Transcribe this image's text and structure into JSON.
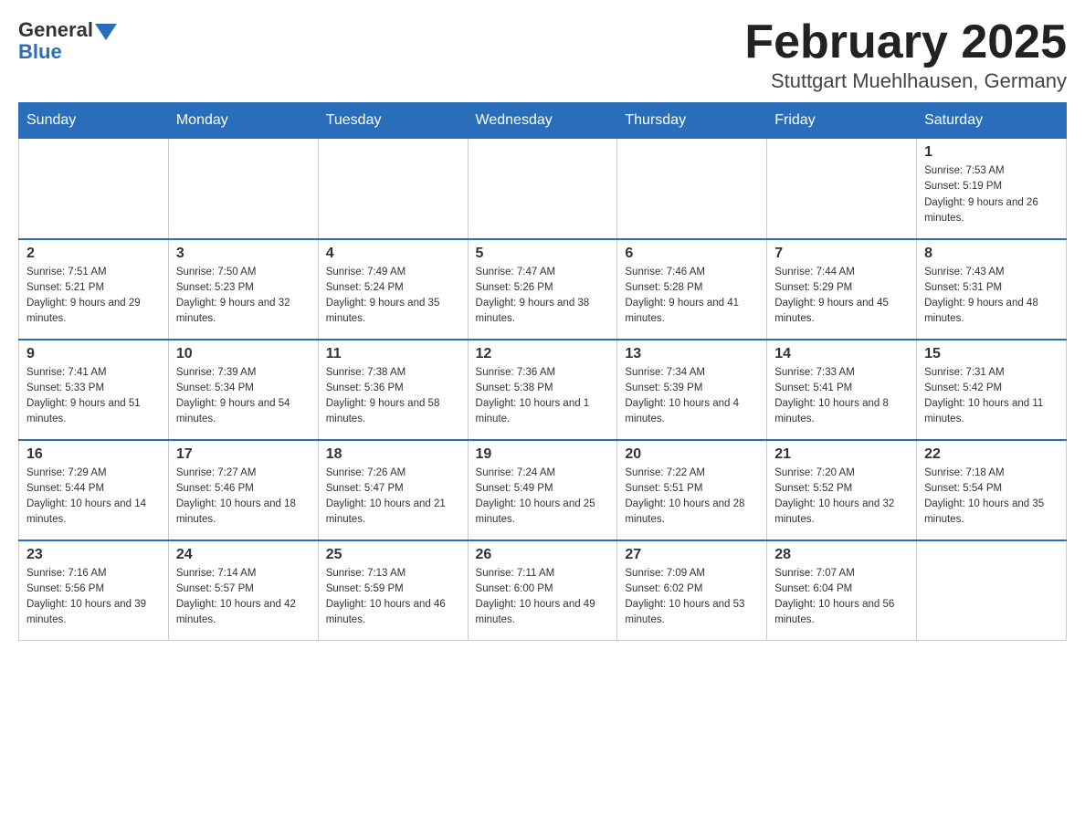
{
  "logo": {
    "general": "General",
    "blue": "Blue"
  },
  "title": "February 2025",
  "location": "Stuttgart Muehlhausen, Germany",
  "weekdays": [
    "Sunday",
    "Monday",
    "Tuesday",
    "Wednesday",
    "Thursday",
    "Friday",
    "Saturday"
  ],
  "weeks": [
    [
      {
        "day": "",
        "info": ""
      },
      {
        "day": "",
        "info": ""
      },
      {
        "day": "",
        "info": ""
      },
      {
        "day": "",
        "info": ""
      },
      {
        "day": "",
        "info": ""
      },
      {
        "day": "",
        "info": ""
      },
      {
        "day": "1",
        "info": "Sunrise: 7:53 AM\nSunset: 5:19 PM\nDaylight: 9 hours and 26 minutes."
      }
    ],
    [
      {
        "day": "2",
        "info": "Sunrise: 7:51 AM\nSunset: 5:21 PM\nDaylight: 9 hours and 29 minutes."
      },
      {
        "day": "3",
        "info": "Sunrise: 7:50 AM\nSunset: 5:23 PM\nDaylight: 9 hours and 32 minutes."
      },
      {
        "day": "4",
        "info": "Sunrise: 7:49 AM\nSunset: 5:24 PM\nDaylight: 9 hours and 35 minutes."
      },
      {
        "day": "5",
        "info": "Sunrise: 7:47 AM\nSunset: 5:26 PM\nDaylight: 9 hours and 38 minutes."
      },
      {
        "day": "6",
        "info": "Sunrise: 7:46 AM\nSunset: 5:28 PM\nDaylight: 9 hours and 41 minutes."
      },
      {
        "day": "7",
        "info": "Sunrise: 7:44 AM\nSunset: 5:29 PM\nDaylight: 9 hours and 45 minutes."
      },
      {
        "day": "8",
        "info": "Sunrise: 7:43 AM\nSunset: 5:31 PM\nDaylight: 9 hours and 48 minutes."
      }
    ],
    [
      {
        "day": "9",
        "info": "Sunrise: 7:41 AM\nSunset: 5:33 PM\nDaylight: 9 hours and 51 minutes."
      },
      {
        "day": "10",
        "info": "Sunrise: 7:39 AM\nSunset: 5:34 PM\nDaylight: 9 hours and 54 minutes."
      },
      {
        "day": "11",
        "info": "Sunrise: 7:38 AM\nSunset: 5:36 PM\nDaylight: 9 hours and 58 minutes."
      },
      {
        "day": "12",
        "info": "Sunrise: 7:36 AM\nSunset: 5:38 PM\nDaylight: 10 hours and 1 minute."
      },
      {
        "day": "13",
        "info": "Sunrise: 7:34 AM\nSunset: 5:39 PM\nDaylight: 10 hours and 4 minutes."
      },
      {
        "day": "14",
        "info": "Sunrise: 7:33 AM\nSunset: 5:41 PM\nDaylight: 10 hours and 8 minutes."
      },
      {
        "day": "15",
        "info": "Sunrise: 7:31 AM\nSunset: 5:42 PM\nDaylight: 10 hours and 11 minutes."
      }
    ],
    [
      {
        "day": "16",
        "info": "Sunrise: 7:29 AM\nSunset: 5:44 PM\nDaylight: 10 hours and 14 minutes."
      },
      {
        "day": "17",
        "info": "Sunrise: 7:27 AM\nSunset: 5:46 PM\nDaylight: 10 hours and 18 minutes."
      },
      {
        "day": "18",
        "info": "Sunrise: 7:26 AM\nSunset: 5:47 PM\nDaylight: 10 hours and 21 minutes."
      },
      {
        "day": "19",
        "info": "Sunrise: 7:24 AM\nSunset: 5:49 PM\nDaylight: 10 hours and 25 minutes."
      },
      {
        "day": "20",
        "info": "Sunrise: 7:22 AM\nSunset: 5:51 PM\nDaylight: 10 hours and 28 minutes."
      },
      {
        "day": "21",
        "info": "Sunrise: 7:20 AM\nSunset: 5:52 PM\nDaylight: 10 hours and 32 minutes."
      },
      {
        "day": "22",
        "info": "Sunrise: 7:18 AM\nSunset: 5:54 PM\nDaylight: 10 hours and 35 minutes."
      }
    ],
    [
      {
        "day": "23",
        "info": "Sunrise: 7:16 AM\nSunset: 5:56 PM\nDaylight: 10 hours and 39 minutes."
      },
      {
        "day": "24",
        "info": "Sunrise: 7:14 AM\nSunset: 5:57 PM\nDaylight: 10 hours and 42 minutes."
      },
      {
        "day": "25",
        "info": "Sunrise: 7:13 AM\nSunset: 5:59 PM\nDaylight: 10 hours and 46 minutes."
      },
      {
        "day": "26",
        "info": "Sunrise: 7:11 AM\nSunset: 6:00 PM\nDaylight: 10 hours and 49 minutes."
      },
      {
        "day": "27",
        "info": "Sunrise: 7:09 AM\nSunset: 6:02 PM\nDaylight: 10 hours and 53 minutes."
      },
      {
        "day": "28",
        "info": "Sunrise: 7:07 AM\nSunset: 6:04 PM\nDaylight: 10 hours and 56 minutes."
      },
      {
        "day": "",
        "info": ""
      }
    ]
  ]
}
